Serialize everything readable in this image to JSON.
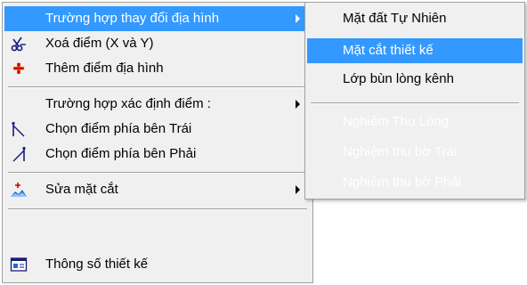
{
  "main_menu": {
    "items": [
      {
        "label": "Trường hợp thay đổi địa hình",
        "icon": "none",
        "submenu": true,
        "selected": true
      },
      {
        "label": "Xoá điểm (X và Y)",
        "icon": "scissors-icon"
      },
      {
        "label": "Thêm điểm  địa hình",
        "icon": "plus-icon"
      },
      {
        "label": "Trường hợp xác định điểm :",
        "icon": "none",
        "submenu": true
      },
      {
        "label": "Chọn điểm phía  bên Trái",
        "icon": "left-point-icon"
      },
      {
        "label": "Chọn điểm phía  bên Phải",
        "icon": "right-point-icon"
      },
      {
        "label": "Sửa mặt cắt",
        "icon": "edit-section-icon",
        "submenu": true
      },
      {
        "label": "Thông số thiết kế",
        "icon": "design-params-icon"
      }
    ]
  },
  "sub_menu": {
    "items": [
      {
        "label": "Mặt đất Tự Nhiên",
        "enabled": true
      },
      {
        "label": "Mặt cắt thiết kế",
        "enabled": true,
        "selected": true
      },
      {
        "label": "Lớp bùn lòng kênh",
        "enabled": true
      },
      {
        "label": "Nghiệm Thu Lòng",
        "enabled": false
      },
      {
        "label": "Nghiệm thu bờ Trái",
        "enabled": false
      },
      {
        "label": "Nghiệm thu bờ Phải",
        "enabled": false
      }
    ]
  },
  "colors": {
    "highlight": "#3399ff",
    "menu_bg": "#f0f0f0",
    "plus_icon": "#cc0000",
    "edit_icon": "#1e6ec8"
  }
}
